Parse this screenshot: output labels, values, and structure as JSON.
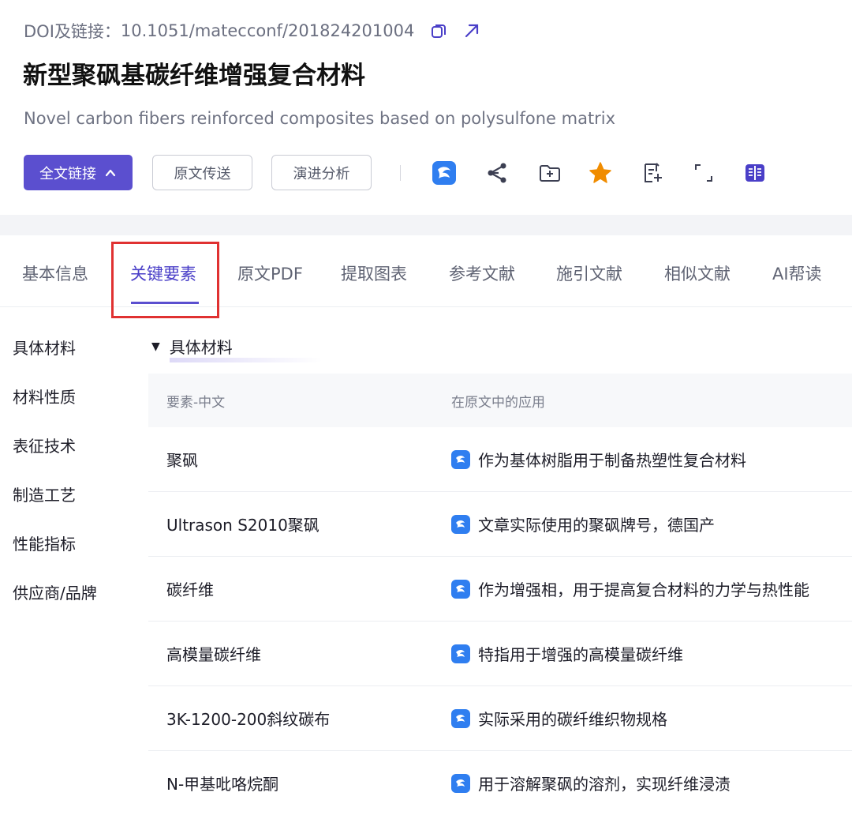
{
  "header": {
    "doi_label": "DOI及链接：",
    "doi_value": "10.1051/matecconf/201824201004",
    "title_cn": "新型聚砜基碳纤维增强复合材料",
    "title_en": "Novel carbon fibers reinforced composites based on polysulfone matrix"
  },
  "actions": {
    "fulltext_link": "全文链接",
    "original_delivery": "原文传送",
    "evolution_analysis": "演进分析"
  },
  "toolbar_icons": [
    "ai-assistant-icon",
    "share-icon",
    "add-folder-icon",
    "star-icon",
    "note-icon",
    "fullscreen-icon",
    "reader-icon"
  ],
  "tabs": [
    {
      "label": "基本信息"
    },
    {
      "label": "关键要素"
    },
    {
      "label": "原文PDF"
    },
    {
      "label": "提取图表"
    },
    {
      "label": "参考文献"
    },
    {
      "label": "施引文献"
    },
    {
      "label": "相似文献"
    },
    {
      "label": "AI帮读"
    }
  ],
  "sidebar": {
    "items": [
      {
        "label": "具体材料"
      },
      {
        "label": "材料性质"
      },
      {
        "label": "表征技术"
      },
      {
        "label": "制造工艺"
      },
      {
        "label": "性能指标"
      },
      {
        "label": "供应商/品牌"
      }
    ]
  },
  "section": {
    "title": "具体材料",
    "columns": [
      "要素-中文",
      "在原文中的应用"
    ],
    "rows": [
      {
        "element": "聚砜",
        "application": "作为基体树脂用于制备热塑性复合材料"
      },
      {
        "element": "Ultrason S2010聚砜",
        "application": "文章实际使用的聚砜牌号，德国产"
      },
      {
        "element": "碳纤维",
        "application": "作为增强相，用于提高复合材料的力学与热性能"
      },
      {
        "element": "高模量碳纤维",
        "application": "特指用于增强的高模量碳纤维"
      },
      {
        "element": "3K-1200-200斜纹碳布",
        "application": "实际采用的碳纤维织物规格"
      },
      {
        "element": "N-甲基吡咯烷酮",
        "application": "用于溶解聚砜的溶剂，实现纤维浸渍"
      }
    ]
  },
  "colors": {
    "primary": "#5b4fcf",
    "highlight_box": "#e03131",
    "star": "#f08c00",
    "ai_icon": "#2f7ef0"
  }
}
